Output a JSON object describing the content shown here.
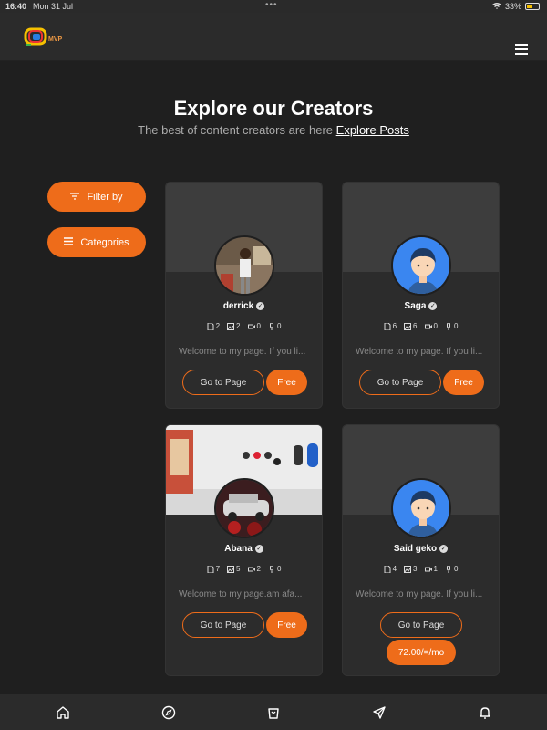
{
  "status": {
    "time": "16:40",
    "date": "Mon 31 Jul",
    "battery": "33%"
  },
  "hero": {
    "title": "Explore our Creators",
    "subtitle": "The best of content creators are here",
    "link": "Explore Posts"
  },
  "filters": {
    "filter_label": "Filter by",
    "categories_label": "Categories"
  },
  "creators": [
    {
      "name": "derrick",
      "posts": "2",
      "images": "2",
      "videos": "0",
      "audio": "0",
      "description": "Welcome to my page. If you li...",
      "page_label": "Go to Page",
      "price": "Free"
    },
    {
      "name": "Saga",
      "posts": "6",
      "images": "6",
      "videos": "0",
      "audio": "0",
      "description": "Welcome to my page. If you li...",
      "page_label": "Go to Page",
      "price": "Free"
    },
    {
      "name": "Abana",
      "posts": "7",
      "images": "5",
      "videos": "2",
      "audio": "0",
      "description": "Welcome to my page.am afa...",
      "page_label": "Go to Page",
      "price": "Free"
    },
    {
      "name": "Said geko",
      "posts": "4",
      "images": "3",
      "videos": "1",
      "audio": "0",
      "description": "Welcome to my page. If you li...",
      "page_label": "Go to Page",
      "price": "72.00/=/mo"
    }
  ],
  "colors": {
    "accent": "#ee6c1a",
    "background": "#1f1f1f",
    "card": "#2c2c2c"
  },
  "nav_icons": [
    "home-icon",
    "compass-icon",
    "shopping-bag-icon",
    "send-icon",
    "bell-icon"
  ]
}
